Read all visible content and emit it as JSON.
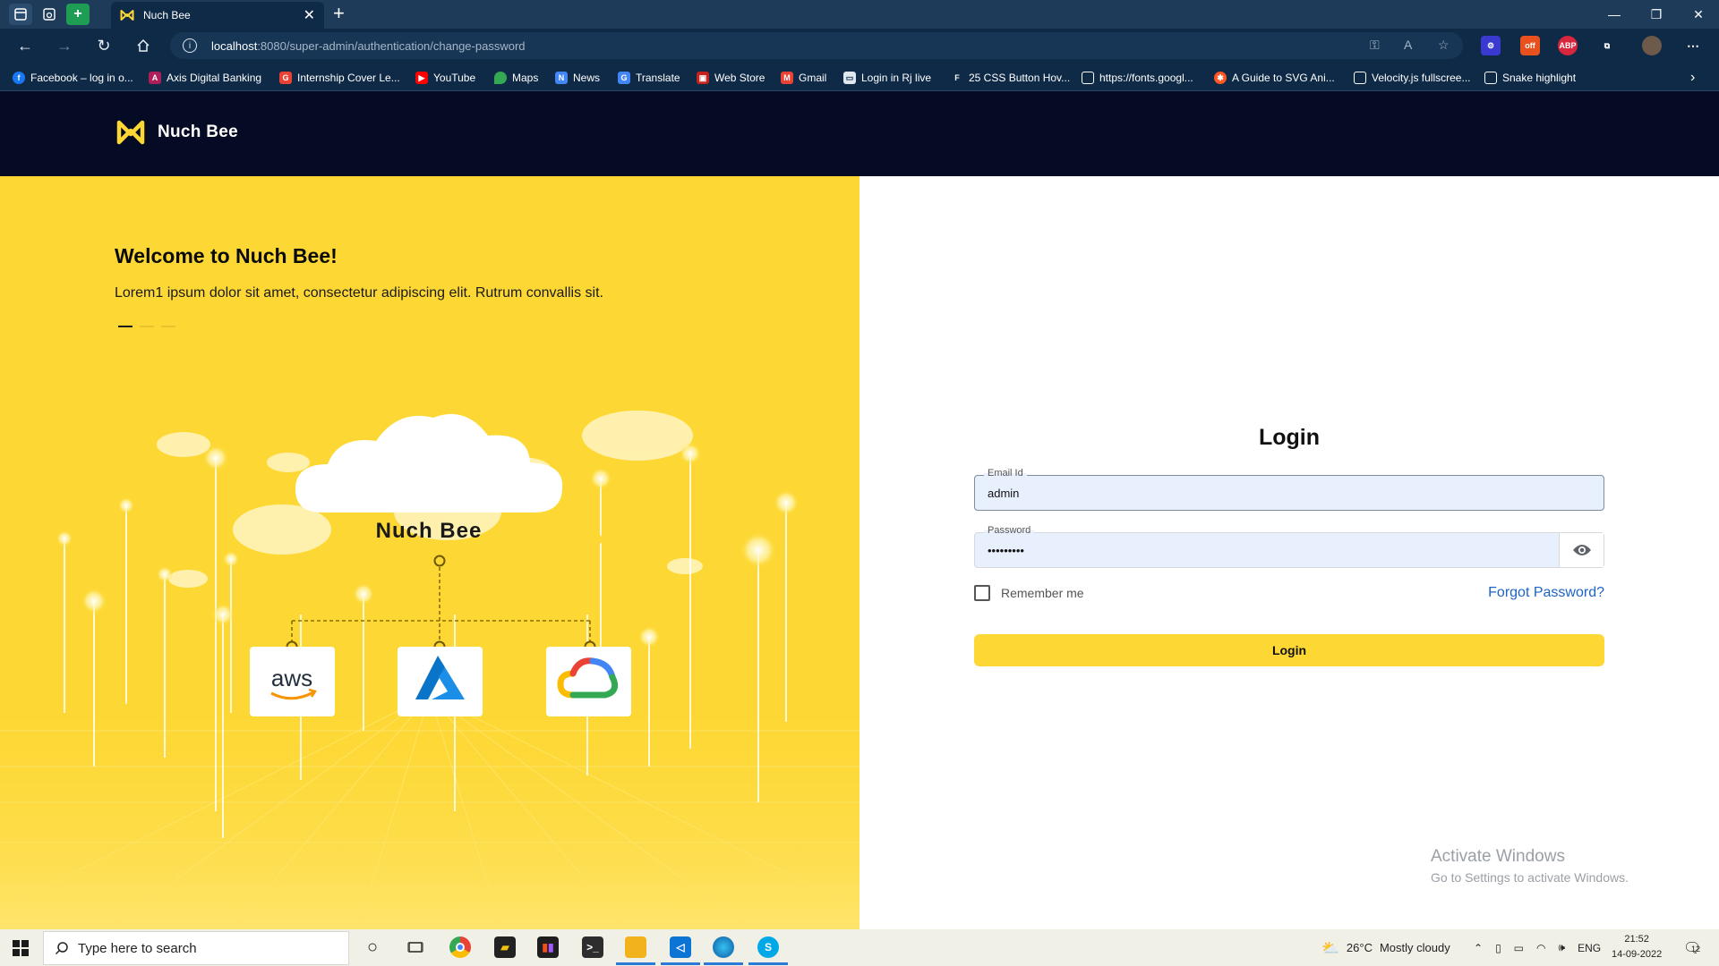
{
  "browser": {
    "tab_title": "Nuch Bee",
    "url_host": "localhost",
    "url_rest": ":8080/super-admin/authentication/change-password",
    "bookmarks": [
      {
        "label": "Facebook – log in o...",
        "color": "#1877f2",
        "glyph": "f"
      },
      {
        "label": "Axis Digital Banking",
        "color": "#ae1e5b",
        "glyph": "A"
      },
      {
        "label": "Internship Cover Le...",
        "color": "#e94235",
        "glyph": "G"
      },
      {
        "label": "YouTube",
        "color": "#ff0000",
        "glyph": "▶"
      },
      {
        "label": "Maps",
        "color": "#34a853",
        "glyph": "⬤"
      },
      {
        "label": "News",
        "color": "#4285f4",
        "glyph": "N"
      },
      {
        "label": "Translate",
        "color": "#4285f4",
        "glyph": "G"
      },
      {
        "label": "Web Store",
        "color": "#c5221f",
        "glyph": "▣"
      },
      {
        "label": "Gmail",
        "color": "#ea4335",
        "glyph": "M"
      },
      {
        "label": "Login in Rj live",
        "color": "#dfe7ef",
        "glyph": "▭"
      },
      {
        "label": "25 CSS Button Hov...",
        "color": "#0f2a47",
        "glyph": "F"
      },
      {
        "label": "https://fonts.googl...",
        "color": "#0f2a47",
        "glyph": "▯"
      },
      {
        "label": "A Guide to SVG Ani...",
        "color": "#ff5722",
        "glyph": "✱"
      },
      {
        "label": "Velocity.js fullscree...",
        "color": "#0f2a47",
        "glyph": "▯"
      },
      {
        "label": "Snake highlight",
        "color": "#0f2a47",
        "glyph": "▯"
      }
    ]
  },
  "app": {
    "brand": "Nuch Bee",
    "welcome_title": "Welcome to Nuch Bee!",
    "welcome_sub": "Lorem1 ipsum dolor sit amet, consectetur adipiscing elit. Rutrum convallis sit.",
    "cloud_label": "Nuch Bee",
    "providers": [
      "aws",
      "Azure",
      "Google Cloud"
    ],
    "aws_text": "aws",
    "carousel": {
      "count": 3,
      "active": 0
    }
  },
  "login": {
    "title": "Login",
    "email_label": "Email Id",
    "email_value": "admin",
    "password_label": "Password",
    "password_value": "•••••••••",
    "remember_label": "Remember me",
    "forgot_label": "Forgot Password?",
    "button_label": "Login",
    "brand_color": "#fdd835",
    "link_color": "#1e63c6"
  },
  "watermark": {
    "line1": "Activate Windows",
    "line2": "Go to Settings to activate Windows."
  },
  "taskbar": {
    "search_placeholder": "Type here to search",
    "weather_temp": "26°C",
    "weather_desc": "Mostly cloudy",
    "lang": "ENG",
    "time": "21:52",
    "date": "14-09-2022",
    "notifications": "12"
  }
}
